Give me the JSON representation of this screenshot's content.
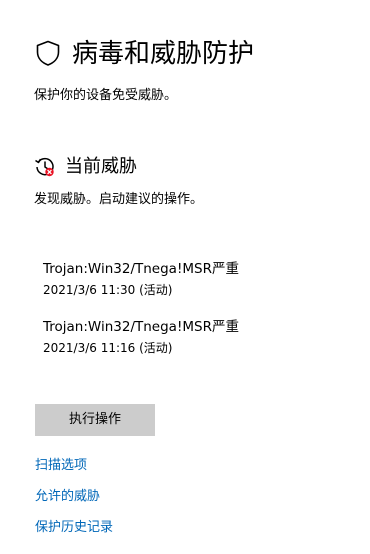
{
  "header": {
    "icon": "shield-icon",
    "title": "病毒和威胁防护",
    "subtitle": "保护你的设备免受威胁。"
  },
  "current_threats": {
    "icon": "threat-history-icon",
    "title": "当前威胁",
    "description": "发现威胁。启动建议的操作。",
    "items": [
      {
        "name": "Trojan:Win32/Tnega!MSR",
        "severity": "严重",
        "time": "2021/3/6 11:30",
        "status": "(活动)"
      },
      {
        "name": "Trojan:Win32/Tnega!MSR",
        "severity": "严重",
        "time": "2021/3/6 11:16",
        "status": "(活动)"
      }
    ]
  },
  "actions": {
    "start_actions_label": "执行操作"
  },
  "links": {
    "scan_options": "扫描选项",
    "allowed_threats": "允许的威胁",
    "protection_history": "保护历史记录"
  },
  "colors": {
    "link": "#0067b8",
    "button_bg": "#cccccc",
    "alert_red": "#e81123"
  }
}
